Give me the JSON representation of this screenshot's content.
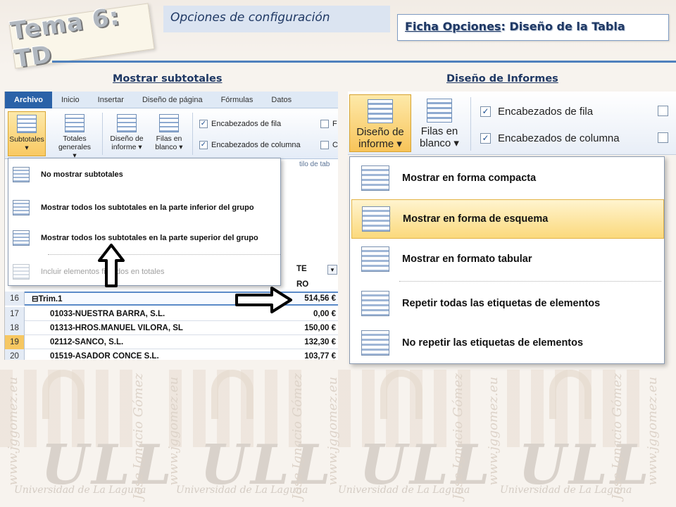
{
  "header": {
    "topic": "Tema 6: TD",
    "section": "Opciones de configuración",
    "ficha_prefix": "Ficha Opciones",
    "ficha_suffix": ": Diseño de la Tabla"
  },
  "captions": {
    "left": "Mostrar subtotales",
    "right": "Diseño de Informes"
  },
  "left_screenshot": {
    "tabs": [
      "Archivo",
      "Inicio",
      "Insertar",
      "Diseño de página",
      "Fórmulas",
      "Datos"
    ],
    "ribbon_buttons": [
      {
        "line1": "Subtotales",
        "line2": "▾"
      },
      {
        "line1": "Totales",
        "line2": "generales ▾"
      },
      {
        "line1": "Diseño de",
        "line2": "informe ▾"
      },
      {
        "line1": "Filas en",
        "line2": "blanco ▾"
      }
    ],
    "checks": [
      {
        "label": "Encabezados de fila",
        "checked": true
      },
      {
        "label": "Encabezados de columna",
        "checked": true
      }
    ],
    "partial_checks": [
      "F",
      "C"
    ],
    "behind_text": "tilo de tab",
    "menu_items": [
      "No mostrar subtotales",
      "Mostrar todos los subtotales en la parte inferior del grupo",
      "Mostrar todos los subtotales en la parte superior del grupo",
      "Incluir elementos filtrados en totales"
    ],
    "col_heads": [
      "TE",
      "RO"
    ],
    "rows": [
      {
        "num": "16",
        "name": "⊟Trim.1",
        "value": "514,56 €",
        "group": true,
        "selected": false
      },
      {
        "num": "17",
        "name": "01033-NUESTRA BARRA, S.L.",
        "value": "0,00 €",
        "group": false,
        "selected": false
      },
      {
        "num": "18",
        "name": "01313-HROS.MANUEL VILORA, SL",
        "value": "150,00 €",
        "group": false,
        "selected": false
      },
      {
        "num": "19",
        "name": "02112-SANCO, S.L.",
        "value": "132,30 €",
        "group": false,
        "selected": true
      },
      {
        "num": "20",
        "name": "01519-ASADOR CONCE S.L.",
        "value": "103,77 €",
        "group": false,
        "selected": false
      }
    ]
  },
  "right_screenshot": {
    "buttons": [
      {
        "line1": "Diseño de",
        "line2": "informe ▾"
      },
      {
        "line1": "Filas en",
        "line2": "blanco ▾"
      }
    ],
    "checks": [
      {
        "label": "Encabezados de fila",
        "checked": true
      },
      {
        "label": "Encabezados de columna",
        "checked": true
      }
    ],
    "menu_items": [
      "Mostrar en forma compacta",
      "Mostrar en forma de esquema",
      "Mostrar en formato tabular",
      "Repetir todas las etiquetas de elementos",
      "No repetir las etiquetas de elementos"
    ],
    "highlighted_index": 1
  },
  "watermark": {
    "logo": "ULL",
    "university": "Universidad de La Laguna",
    "author": "Jose Ignacio Gómez",
    "site": "www.jggomez.eu"
  },
  "colors": {
    "accent_blue": "#4f81bd",
    "title_navy": "#1f3864",
    "highlight_gold": "#fbd97c",
    "arrow": "#000000"
  }
}
